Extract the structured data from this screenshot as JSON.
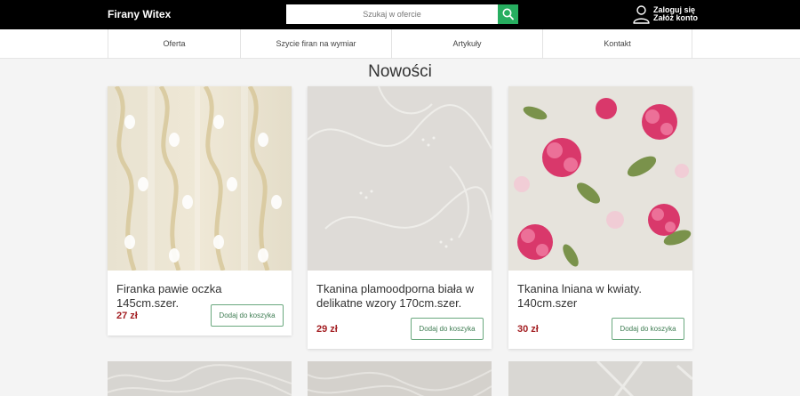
{
  "header": {
    "brand": "Firany Witex",
    "search_placeholder": "Szukaj w ofercie",
    "account_line1": "Zaloguj się",
    "account_line2": "Załóż konto"
  },
  "nav": {
    "items": [
      {
        "label": "Oferta"
      },
      {
        "label": "Szycie firan na wymiar"
      },
      {
        "label": "Artykuły"
      },
      {
        "label": "Kontakt"
      }
    ]
  },
  "section": {
    "title": "Nowości"
  },
  "products": [
    {
      "title": "Firanka pawie oczka 145cm.szer.",
      "price": "27 zł",
      "button": "Dodaj do koszyka"
    },
    {
      "title": "Tkanina plamoodporna biała w delikatne wzory 170cm.szer.",
      "price": "29 zł",
      "button": "Dodaj do koszyka"
    },
    {
      "title": "Tkanina lniana w kwiaty. 140cm.szer",
      "price": "30 zł",
      "button": "Dodaj do koszyka"
    }
  ],
  "colors": {
    "accent": "#27ae60",
    "price": "#a31e22",
    "topbar": "#000000"
  }
}
